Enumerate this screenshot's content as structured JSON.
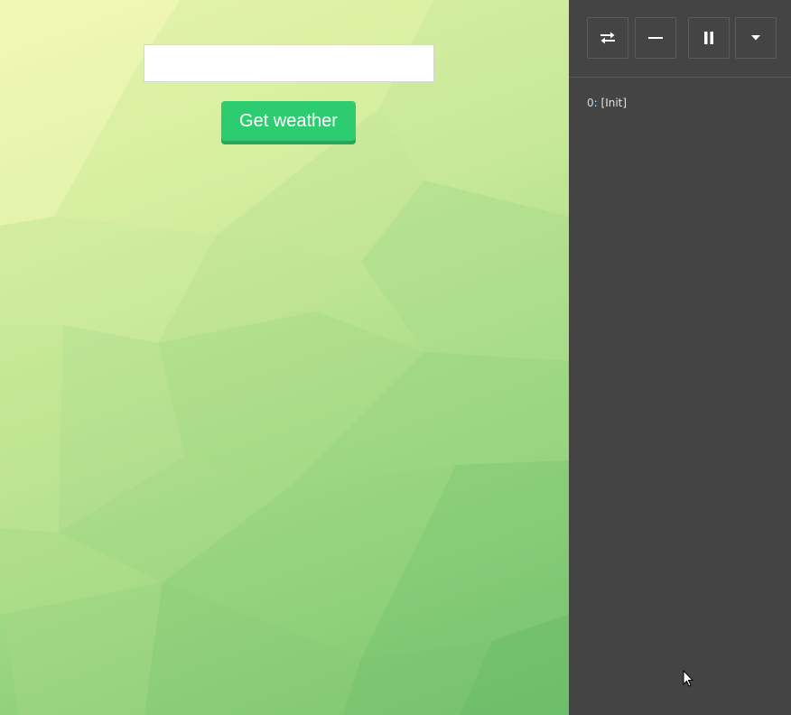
{
  "weather_app": {
    "city_input": {
      "value": "",
      "placeholder": ""
    },
    "get_weather_button": {
      "label": "Get weather"
    },
    "colors": {
      "button": "#2ecc71",
      "button_shadow": "#25a85c",
      "background_light": "#eef7b4",
      "background_dark": "#6fbf6a"
    }
  },
  "devtools": {
    "toolbar": [
      {
        "name": "swap-position",
        "icon": "swap-arrows-icon"
      },
      {
        "name": "minimize",
        "icon": "minus-icon"
      },
      {
        "name": "pause-recording",
        "icon": "pause-icon"
      },
      {
        "name": "more-options",
        "icon": "caret-down-icon"
      }
    ],
    "log": [
      {
        "index": "0:",
        "action": "[Init]"
      }
    ],
    "colors": {
      "panel_bg": "#444444",
      "log_index": "#b5dfff",
      "log_text": "#e4e4e4"
    }
  }
}
